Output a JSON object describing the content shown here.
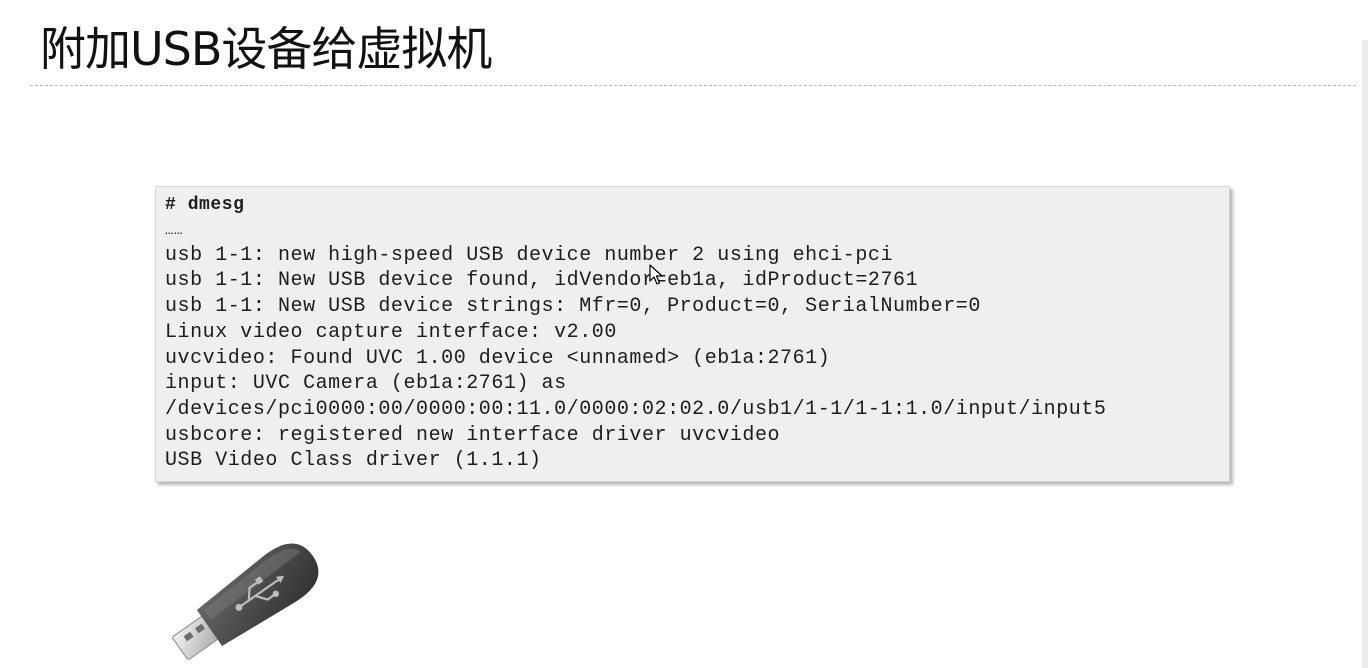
{
  "slide": {
    "title": "附加USB设备给虚拟机"
  },
  "terminal": {
    "command": "# dmesg",
    "ellipsis": "……",
    "lines": [
      "usb 1-1: new high-speed USB device number 2 using ehci-pci",
      "usb 1-1: New USB device found, idVendor=eb1a, idProduct=2761",
      "usb 1-1: New USB device strings: Mfr=0, Product=0, SerialNumber=0",
      "Linux video capture interface: v2.00",
      "uvcvideo: Found UVC 1.00 device <unnamed> (eb1a:2761)",
      "input: UVC Camera (eb1a:2761) as",
      "/devices/pci0000:00/0000:00:11.0/0000:02:02.0/usb1/1-1/1-1:1.0/input/input5",
      "usbcore: registered new interface driver uvcvideo",
      "USB Video Class driver (1.1.1)"
    ]
  },
  "illustration": {
    "icon": "usb-flash-drive-icon",
    "body_color": "#4a4a4a",
    "connector_color": "#d8d8d8"
  },
  "pointer": {
    "icon": "mouse-cursor-icon"
  }
}
